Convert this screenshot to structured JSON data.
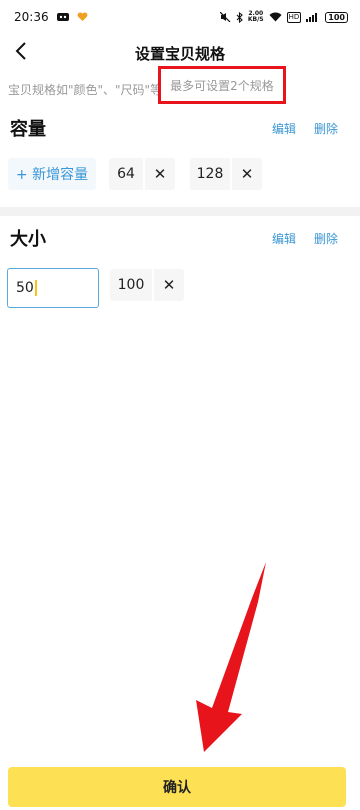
{
  "status_bar": {
    "time": "20:36",
    "net_speed": "2.00\nKB/S",
    "hd": "HD",
    "battery": "100",
    "icons": [
      "tiktok-icon",
      "heart-app-icon",
      "mute-icon",
      "bluetooth-icon",
      "wifi-icon",
      "signal-icon"
    ]
  },
  "nav": {
    "title": "设置宝贝规格",
    "back_icon": "chevron-left-icon"
  },
  "hint": {
    "prefix": "宝贝规格如\"颜色\"、\"尺码\"等",
    "highlight": "最多可设置2个规格"
  },
  "spec1": {
    "title": "容量",
    "edit": "编辑",
    "delete": "删除",
    "add_label": "+ 新增容量",
    "chips": [
      {
        "value": "64",
        "remove": "✕"
      },
      {
        "value": "128",
        "remove": "✕"
      }
    ]
  },
  "spec2": {
    "title": "大小",
    "edit": "编辑",
    "delete": "删除",
    "input_value": "50",
    "chips": [
      {
        "value": "100",
        "remove": "✕"
      }
    ]
  },
  "confirm": {
    "label": "确认"
  },
  "colors": {
    "accent_blue": "#3a96d4",
    "annotation_red": "#e8141c",
    "confirm_yellow": "#fde053"
  }
}
